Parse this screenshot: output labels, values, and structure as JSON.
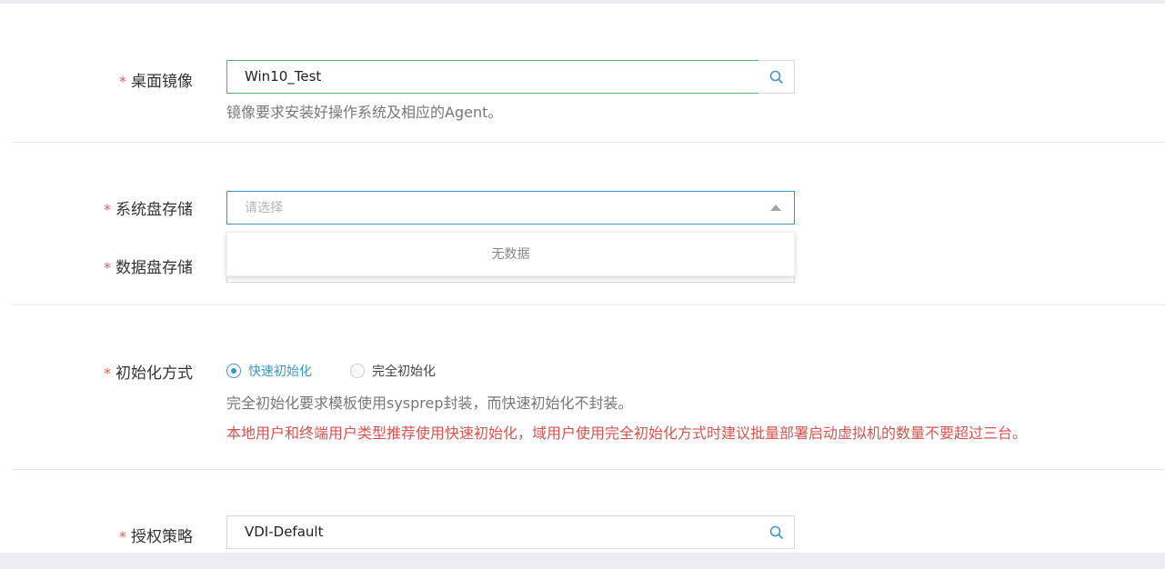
{
  "form": {
    "desktop_image": {
      "required_mark": "*",
      "label": "桌面镜像",
      "value": "Win10_Test",
      "help": "镜像要求安装好操作系统及相应的Agent。",
      "search_icon": "search-icon"
    },
    "system_disk_storage": {
      "required_mark": "*",
      "label": "系统盘存储",
      "placeholder": "请选择",
      "dropdown_empty": "无数据",
      "caret_icon": "caret-up-icon"
    },
    "data_disk_storage": {
      "required_mark": "*",
      "label": "数据盘存储"
    },
    "init_method": {
      "required_mark": "*",
      "label": "初始化方式",
      "options": [
        {
          "label": "快速初始化",
          "checked": true
        },
        {
          "label": "完全初始化",
          "checked": false
        }
      ],
      "help": "完全初始化要求模板使用sysprep封装，而快速初始化不封装。",
      "warning": "本地用户和终端用户类型推荐使用快速初始化，域用户使用完全初始化方式时建议批量部署启动虚拟机的数量不要超过三台。"
    },
    "auth_policy": {
      "required_mark": "*",
      "label": "授权策略",
      "value": "VDI-Default",
      "search_icon": "search-icon"
    }
  },
  "colors": {
    "required": "#e05a5a",
    "accent_blue": "#3a97c9",
    "accent_green": "#52b66d",
    "warning": "#d9534f"
  }
}
